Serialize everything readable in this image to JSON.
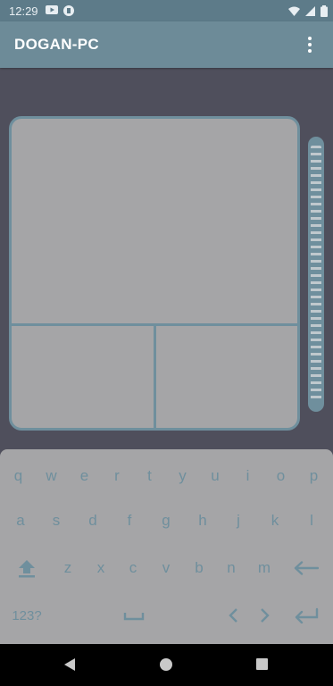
{
  "status_bar": {
    "time": "12:29"
  },
  "app_bar": {
    "title": "DOGAN-PC"
  },
  "keyboard": {
    "row1": [
      "q",
      "w",
      "e",
      "r",
      "t",
      "y",
      "u",
      "i",
      "o",
      "p"
    ],
    "row2": [
      "a",
      "s",
      "d",
      "f",
      "g",
      "h",
      "j",
      "k",
      "l"
    ],
    "row3": [
      "z",
      "x",
      "c",
      "v",
      "b",
      "n",
      "m"
    ],
    "numbers_label": "123?"
  },
  "icons": {
    "status_left": [
      "youtube-icon",
      "app-notification-icon"
    ],
    "status_right": [
      "wifi-icon",
      "signal-icon",
      "battery-icon"
    ],
    "menu": "overflow-menu-icon",
    "shift": "shift-icon",
    "backspace": "backspace-icon",
    "space": "space-icon",
    "left": "arrow-left-icon",
    "right": "arrow-right-icon",
    "enter": "enter-icon"
  },
  "colors": {
    "accent": "#6f8f9d",
    "appbar": "#6d8b98",
    "background": "#4f4f5c",
    "pad": "#a5a5a7"
  }
}
